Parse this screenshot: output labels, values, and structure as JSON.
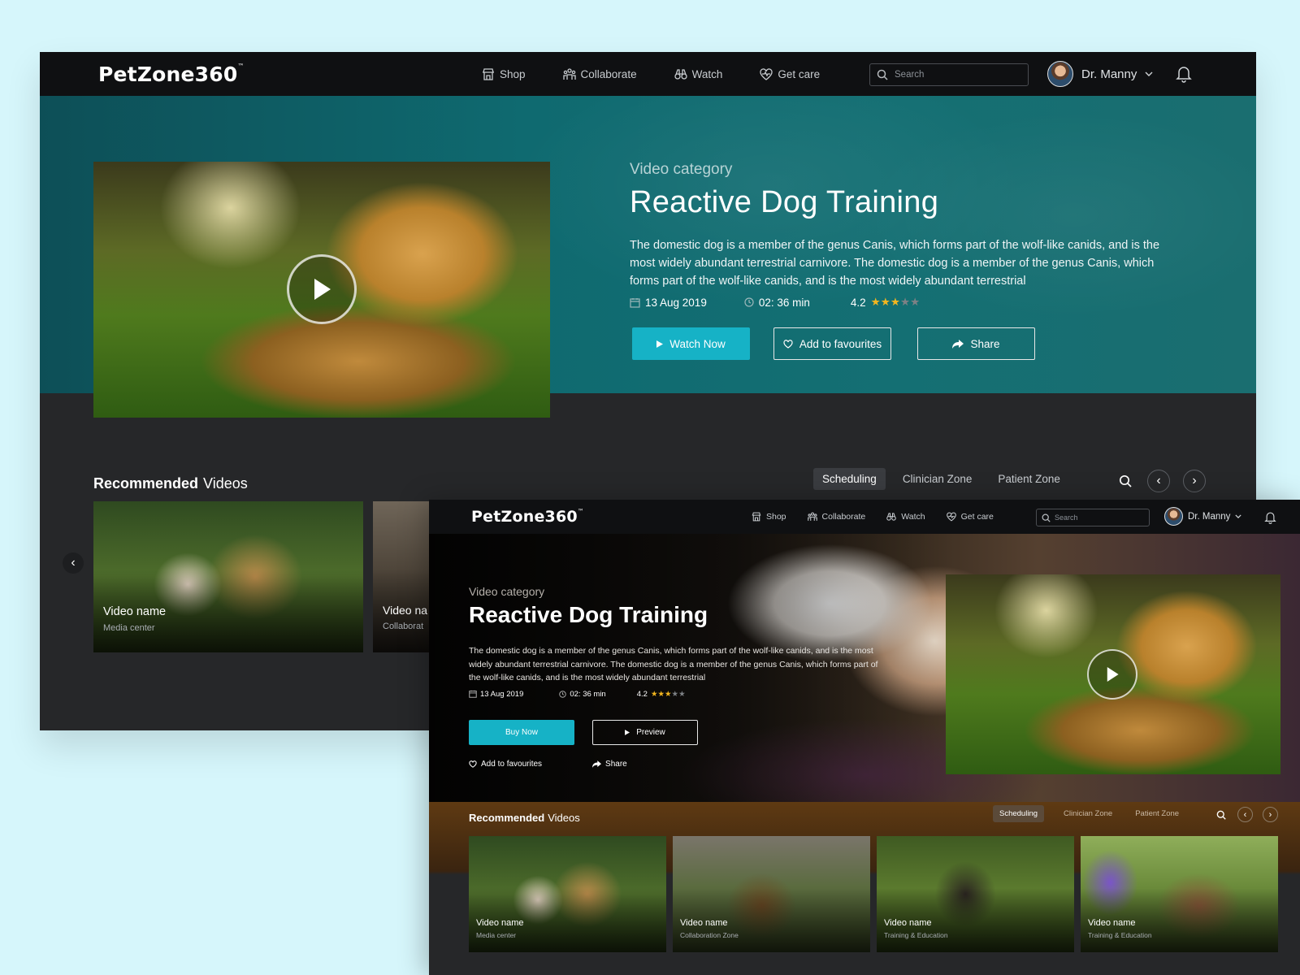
{
  "brand": {
    "name": "PetZone360",
    "tm": "™"
  },
  "nav": {
    "items": [
      {
        "label": "Shop",
        "icon": "shop-icon"
      },
      {
        "label": "Collaborate",
        "icon": "collaborate-icon"
      },
      {
        "label": "Watch",
        "icon": "binoculars-icon"
      },
      {
        "label": "Get care",
        "icon": "heart-pulse-icon"
      }
    ],
    "search_placeholder": "Search",
    "user_name": "Dr. Manny"
  },
  "video": {
    "category": "Video category",
    "title": "Reactive Dog Training",
    "description": "The domestic dog is a member of the genus Canis, which forms part of the wolf-like canids, and is the most widely abundant terrestrial carnivore. The domestic dog is a member of the genus Canis, which forms part of the wolf-like canids, and is the most widely abundant terrestrial",
    "date": "13 Aug 2019",
    "duration": "02: 36 min",
    "rating": "4.2",
    "rating_value": 4.2,
    "stars_filled": 3,
    "stars_total": 5
  },
  "window1": {
    "buttons": {
      "watch_now": "Watch Now",
      "add_favourites": "Add to favourites",
      "share": "Share"
    },
    "cards": [
      {
        "name": "Video name",
        "sub": "Media center"
      },
      {
        "name": "Video na",
        "sub": "Collaborat"
      }
    ]
  },
  "window2": {
    "buttons": {
      "buy_now": "Buy Now",
      "preview": "Preview"
    },
    "links": {
      "add_favourites": "Add to favourites",
      "share": "Share"
    },
    "cards": [
      {
        "name": "Video name",
        "sub": "Media center"
      },
      {
        "name": "Video name",
        "sub": "Collaboration Zone"
      },
      {
        "name": "Video name",
        "sub": "Training & Education"
      },
      {
        "name": "Video name",
        "sub": "Training & Education"
      }
    ]
  },
  "recommended": {
    "bold": "Recommended",
    "rest": "Videos"
  },
  "tabs": [
    "Scheduling",
    "Clinician Zone",
    "Patient Zone"
  ],
  "active_tab": "Scheduling",
  "colors": {
    "accent": "#16b2c6",
    "hero_teal": "#0f6a70",
    "star": "#f2b51f",
    "nav_bg": "#0f1012"
  }
}
